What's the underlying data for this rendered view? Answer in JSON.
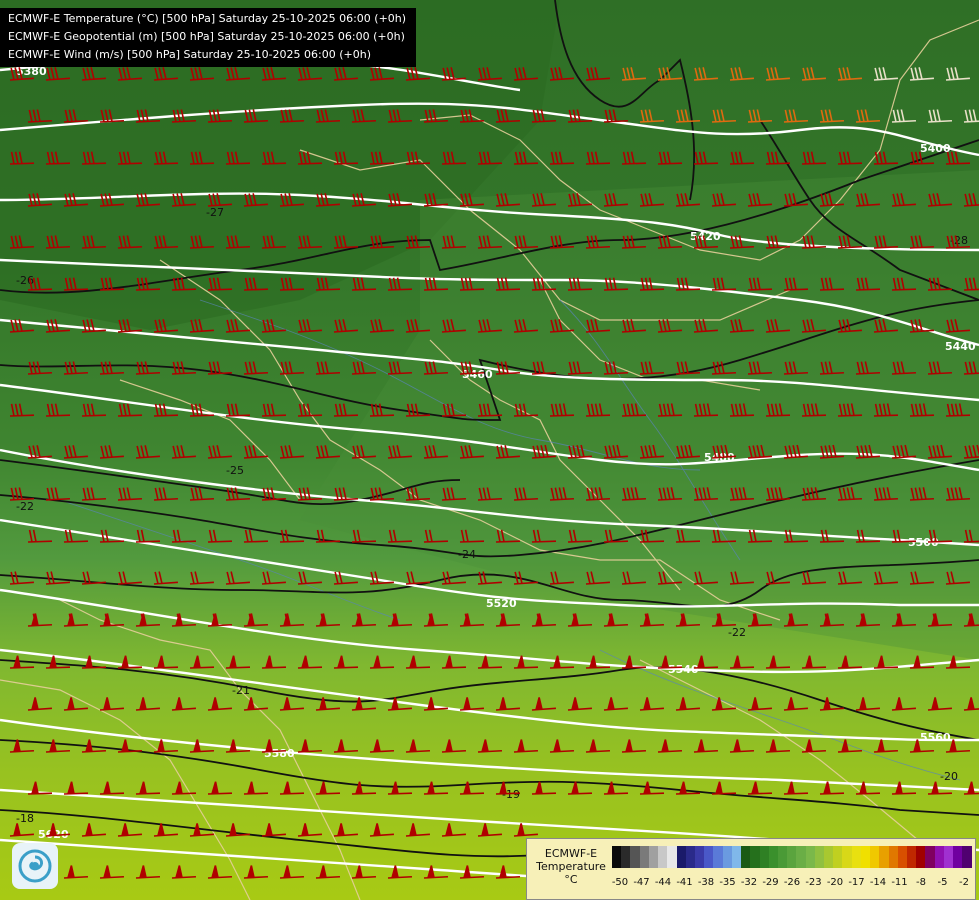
{
  "header": {
    "lines": [
      "ECMWF-E Temperature (°C) [500 hPa] Saturday 25-10-2025 06:00 (+0h)",
      "ECMWF-E Geopotential (m) [500 hPa] Saturday 25-10-2025 06:00 (+0h)",
      "ECMWF-E Wind (m/s) [500 hPa] Saturday 25-10-2025 06:00 (+0h)"
    ]
  },
  "geopotential_labels": [
    "5380",
    "5400",
    "5420",
    "5440",
    "5460",
    "5480",
    "5500",
    "5520",
    "5540",
    "5560",
    "5580",
    "5620"
  ],
  "temperature_labels": [
    "-27",
    "-26",
    "-25",
    "-22",
    "-24",
    "-22",
    "-21",
    "-19",
    "-18",
    "-20",
    "-28"
  ],
  "colorbar": {
    "title": "ECMWF-E",
    "subtitle": "Temperature",
    "unit": "°C",
    "tick_labels": [
      "-50",
      "-47",
      "-44",
      "-41",
      "-38",
      "-35",
      "-32",
      "-29",
      "-26",
      "-23",
      "-20",
      "-17",
      "-14",
      "-11",
      "-8",
      "-5",
      "-2"
    ],
    "colors": [
      "#0a0a0a",
      "#2a2a2a",
      "#555",
      "#7a7a7a",
      "#a0a0a0",
      "#c8c8c8",
      "#e8e8e8",
      "#1a1a6a",
      "#2a2a8a",
      "#3a3aa8",
      "#4a58c8",
      "#5a7ad8",
      "#6a9ae0",
      "#80b8ea",
      "#1a5a14",
      "#25701c",
      "#2f8024",
      "#3a902c",
      "#4a9a36",
      "#5aa43e",
      "#6aae46",
      "#7ab84a",
      "#90c040",
      "#a8c830",
      "#c0d020",
      "#d8d818",
      "#e8e010",
      "#f0e000",
      "#f0c800",
      "#e8a000",
      "#e07800",
      "#d85000",
      "#c02800",
      "#a00000",
      "#800060",
      "#9010b0",
      "#a030d0",
      "#7000a0",
      "#500070"
    ]
  },
  "logo": {
    "icon": "swirl-logo-icon"
  }
}
